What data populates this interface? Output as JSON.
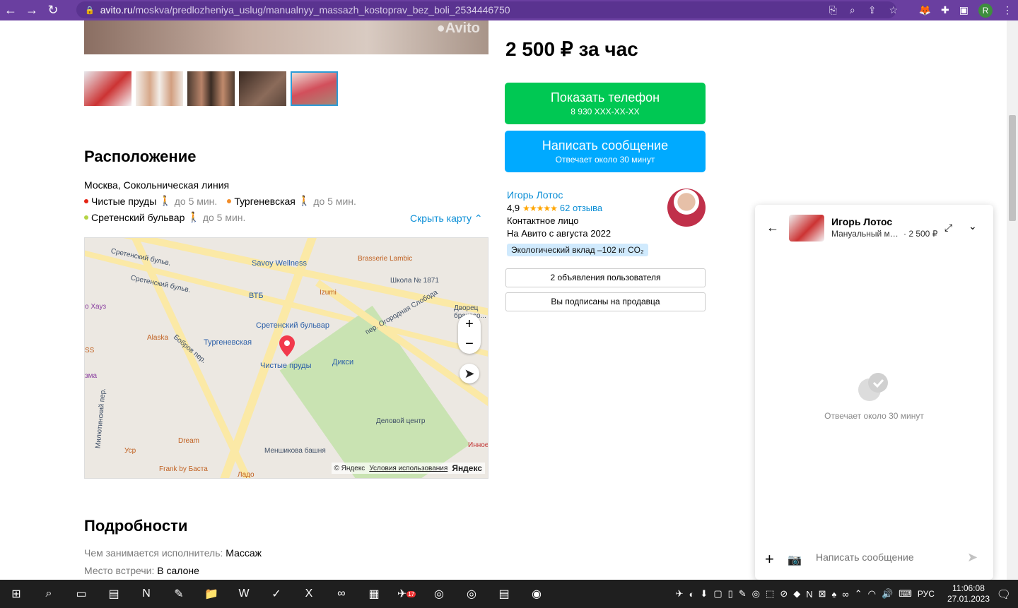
{
  "browser": {
    "url_host": "avito.ru",
    "url_path": "/moskva/predlozheniya_uslug/manualnyy_massazh_kostoprav_bez_boli_2534446750"
  },
  "location": {
    "title": "Расположение",
    "address": "Москва, Сокольническая линия",
    "metro": [
      {
        "name": "Чистые пруды",
        "walk": "до 5 мин.",
        "color": "#e42313"
      },
      {
        "name": "Тургеневская",
        "walk": "до 5 мин.",
        "color": "#f28c28"
      },
      {
        "name": "Сретенский бульвар",
        "walk": "до 5 мин.",
        "color": "#b4d445"
      }
    ],
    "hide_map": "Скрыть карту"
  },
  "map": {
    "labels": {
      "sretensky1": "Сретенский бульв.",
      "sretensky2": "Сретенский бульв.",
      "savoy": "Savoy Wellness",
      "brasserie": "Brasserie Lambic",
      "school": "Школа № 1871",
      "vtb": "ВТБ",
      "izumi": "Izumi",
      "dvorets": "Дворец бракосо...",
      "sretensky_station": "Сретенский бульвар",
      "turgenevskaya": "Тургеневская",
      "chistye": "Чистые пруды",
      "dixi": "Дикси",
      "alaska": "Alaska",
      "ogorodnaya": "пер. Огородная Слобода",
      "delovoy": "Деловой центр",
      "dream": "Dream",
      "menshikova": "Меншикова башня",
      "frank": "Frank by Баста",
      "lado": "Ладо",
      "ysr": "Усp",
      "innov": "Инное",
      "milyutinsky": "Милютинский пер.",
      "bobrov": "Бобров пер.",
      "hayz": "о Хауз",
      "zma": "зма",
      "ss": "SS"
    },
    "copyright": "© Яндекс",
    "terms": "Условия использования",
    "brand": "Яндекс"
  },
  "details": {
    "title": "Подробности",
    "rows": [
      {
        "key": "Чем занимается исполнитель:",
        "value": "Массаж"
      },
      {
        "key": "Место встречи:",
        "value": "В салоне"
      }
    ]
  },
  "offer": {
    "price": "2 500 ₽ за час",
    "phone_btn": "Показать телефон",
    "phone_sub": "8 930 XXX-XX-XX",
    "msg_btn": "Написать сообщение",
    "msg_sub": "Отвечает около 30 минут"
  },
  "seller": {
    "name": "Игорь Лотос",
    "rating": "4,9",
    "stars": "★★★★★",
    "reviews": "62 отзыва",
    "role": "Контактное лицо",
    "since": "На Авито с августа 2022",
    "eco": "Экологический вклад –102 кг CO₂",
    "ads_btn": "2 объявления пользователя",
    "sub_btn": "Вы подписаны на продавца"
  },
  "chat": {
    "title": "Игорь Лотос",
    "ad_title": "Мануальный массаж костоправ без боли",
    "ad_price": "· 2 500 ₽",
    "empty_text": "Отвечает около 30 минут",
    "placeholder": "Написать сообщение"
  },
  "taskbar": {
    "lang": "РУС",
    "time": "11:06:08",
    "date": "27.01.2023",
    "telegram_badge": "17"
  }
}
